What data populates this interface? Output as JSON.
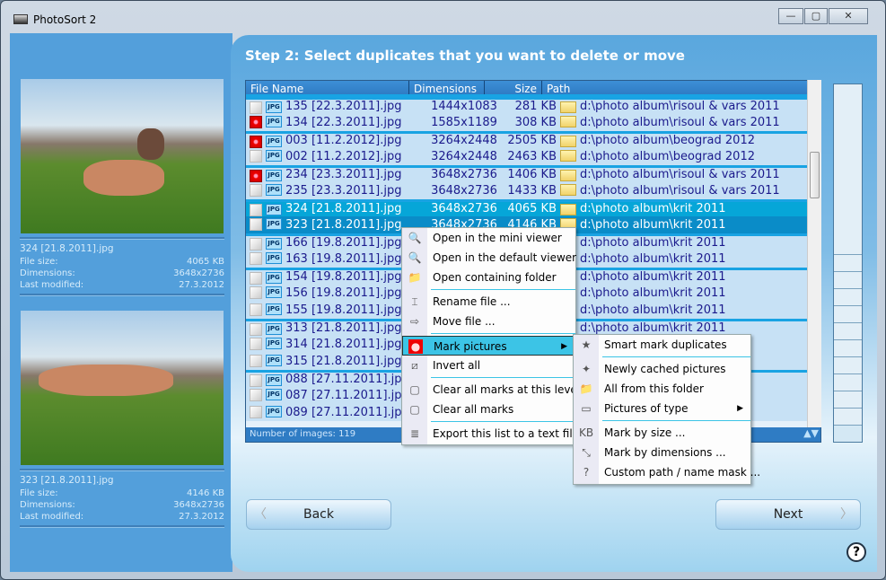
{
  "window": {
    "title": "PhotoSort 2",
    "buttons": [
      "—",
      "▢",
      "✕"
    ]
  },
  "left": {
    "items": [
      {
        "file": "324 [21.8.2011].jpg",
        "labels": [
          "File size:",
          "Dimensions:",
          "Last modified:"
        ],
        "values": [
          "4065 KB",
          "3648x2736",
          "27.3.2012"
        ]
      },
      {
        "file": "323 [21.8.2011].jpg",
        "labels": [
          "File size:",
          "Dimensions:",
          "Last modified:"
        ],
        "values": [
          "4146 KB",
          "3648x2736",
          "27.3.2012"
        ]
      }
    ]
  },
  "heading": "Step 2:  Select duplicates that you want to delete or move",
  "table": {
    "columns": [
      "File Name",
      "Dimensions",
      "Size",
      "Path"
    ],
    "rows": [
      {
        "name": "135 [22.3.2011].jpg",
        "dim": "1444x1083",
        "size": "281 KB",
        "path": "d:\\photo album\\risoul & vars 2011",
        "marked": false,
        "sep": true
      },
      {
        "name": "134 [22.3.2011].jpg",
        "dim": "1585x1189",
        "size": "308 KB",
        "path": "d:\\photo album\\risoul & vars 2011",
        "marked": true
      },
      {
        "name": "003 [11.2.2012].jpg",
        "dim": "3264x2448",
        "size": "2505 KB",
        "path": "d:\\photo album\\beograd 2012",
        "marked": true,
        "sep": true
      },
      {
        "name": "002 [11.2.2012].jpg",
        "dim": "3264x2448",
        "size": "2463 KB",
        "path": "d:\\photo album\\beograd 2012",
        "marked": false
      },
      {
        "name": "234 [23.3.2011].jpg",
        "dim": "3648x2736",
        "size": "1406 KB",
        "path": "d:\\photo album\\risoul & vars 2011",
        "marked": true,
        "sep": true
      },
      {
        "name": "235 [23.3.2011].jpg",
        "dim": "3648x2736",
        "size": "1433 KB",
        "path": "d:\\photo album\\risoul & vars 2011",
        "marked": false
      },
      {
        "name": "324 [21.8.2011].jpg",
        "dim": "3648x2736",
        "size": "4065 KB",
        "path": "d:\\photo album\\krit 2011",
        "marked": false,
        "sep": true,
        "sel": 1
      },
      {
        "name": "323 [21.8.2011].jpg",
        "dim": "3648x2736",
        "size": "4146 KB",
        "path": "d:\\photo album\\krit 2011",
        "marked": false,
        "sel": 2
      },
      {
        "name": "166 [19.8.2011].jpg",
        "dim": "",
        "size": "",
        "path": "d:\\photo album\\krit 2011",
        "marked": false,
        "sep": true
      },
      {
        "name": "163 [19.8.2011].jpg",
        "dim": "",
        "size": "",
        "path": "d:\\photo album\\krit 2011",
        "marked": false
      },
      {
        "name": "154 [19.8.2011].jpg",
        "dim": "",
        "size": "",
        "path": "d:\\photo album\\krit 2011",
        "marked": false,
        "sep": true
      },
      {
        "name": "156 [19.8.2011].jpg",
        "dim": "",
        "size": "",
        "path": "d:\\photo album\\krit 2011",
        "marked": false
      },
      {
        "name": "155 [19.8.2011].jpg",
        "dim": "",
        "size": "",
        "path": "d:\\photo album\\krit 2011",
        "marked": false
      },
      {
        "name": "313 [21.8.2011].jpg",
        "dim": "",
        "size": "",
        "path": "d:\\photo album\\krit 2011",
        "marked": false,
        "sep": true
      },
      {
        "name": "314 [21.8.2011].jpg",
        "dim": "",
        "size": "",
        "path": "",
        "marked": false
      },
      {
        "name": "315 [21.8.2011].jpg",
        "dim": "",
        "size": "",
        "path": "",
        "marked": false
      },
      {
        "name": "088 [27.11.2011].jpg",
        "dim": "",
        "size": "",
        "path": "",
        "marked": false,
        "sep": true
      },
      {
        "name": "087 [27.11.2011].jpg",
        "dim": "",
        "size": "",
        "path": "",
        "marked": false
      },
      {
        "name": "089 [27.11.2011].jpg",
        "dim": "",
        "size": "",
        "path": "",
        "marked": false
      }
    ],
    "footer": "Number of images: 119",
    "type_badge": "JPG"
  },
  "buttons": {
    "back": "Back",
    "next": "Next",
    "help": "?"
  },
  "context_menu": [
    {
      "label": "Open in the mini viewer",
      "icon": "magnifier-icon",
      "glyph": "🔍"
    },
    {
      "label": "Open in the default viewer",
      "icon": "magnifier-icon",
      "glyph": "🔍"
    },
    {
      "label": "Open containing folder",
      "icon": "folder-icon",
      "glyph": "📁",
      "sep_after": true
    },
    {
      "label": "Rename file ...",
      "icon": "rename-icon",
      "glyph": "⌶"
    },
    {
      "label": "Move file ...",
      "icon": "arrow-right-icon",
      "glyph": "⇨",
      "sep_after": true
    },
    {
      "label": "Mark pictures",
      "icon": "mark-icon",
      "glyph": "●",
      "highlight": true,
      "submenu": true
    },
    {
      "label": "Invert all",
      "icon": "invert-icon",
      "glyph": "⧄",
      "sep_after": true
    },
    {
      "label": "Clear all marks at this level",
      "icon": "checkbox-icon",
      "glyph": "▢"
    },
    {
      "label": "Clear all marks",
      "icon": "checkbox-icon",
      "glyph": "▢",
      "sep_after": true
    },
    {
      "label": "Export this list to a text file ...",
      "icon": "document-icon",
      "glyph": "≣"
    }
  ],
  "submenu": [
    {
      "label": "Smart mark duplicates",
      "icon": "smart-mark-icon",
      "glyph": "★",
      "sep_after": true
    },
    {
      "label": "Newly cached pictures",
      "icon": "star-icon",
      "glyph": "✦"
    },
    {
      "label": "All from this folder",
      "icon": "folder-icon",
      "glyph": "📁"
    },
    {
      "label": "Pictures of type",
      "icon": "image-type-icon",
      "glyph": "▭",
      "submenu": true,
      "sep_after": true
    },
    {
      "label": "Mark by size ...",
      "icon": "kb-icon",
      "glyph": "KB"
    },
    {
      "label": "Mark by dimensions ...",
      "icon": "dimensions-icon",
      "glyph": "⤡"
    },
    {
      "label": "Custom path / name mask ...",
      "icon": "mask-icon",
      "glyph": "?"
    }
  ]
}
